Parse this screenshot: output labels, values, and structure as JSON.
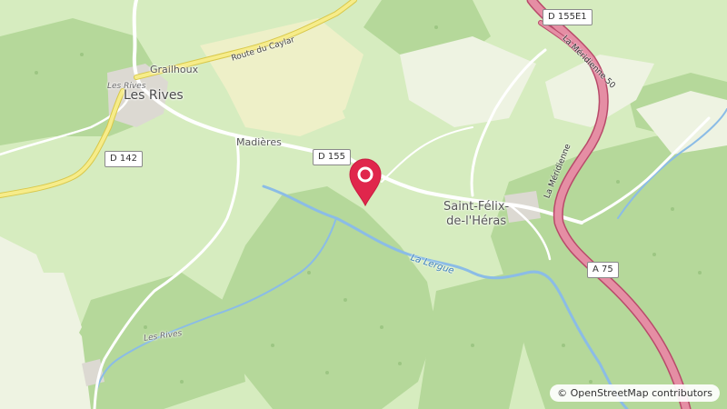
{
  "map": {
    "places": {
      "grailhoux": "Grailhoux",
      "les_rives_small": "Les Rives",
      "les_rives_town": "Les Rives",
      "madieres": "Madières",
      "saint_felix_line1": "Saint-Félix-",
      "saint_felix_line2": "de-l'Héras",
      "les_rives_south": "Les Rives"
    },
    "roads": {
      "d142": "D 142",
      "d155": "D 155",
      "d155e1": "D 155E1",
      "a75": "A 75",
      "route_du_caylar": "Route du Caylar",
      "la_meridienne": "La Méridienne",
      "la_meridienne_num": "50",
      "la_meridienne_2": "La Méridienne"
    },
    "rivers": {
      "la_lergue": "La Lergue"
    },
    "marker_icon": "map-pin-icon",
    "marker_color": "#e0264c"
  },
  "attribution": {
    "symbol": "©",
    "text": "OpenStreetMap contributors"
  }
}
